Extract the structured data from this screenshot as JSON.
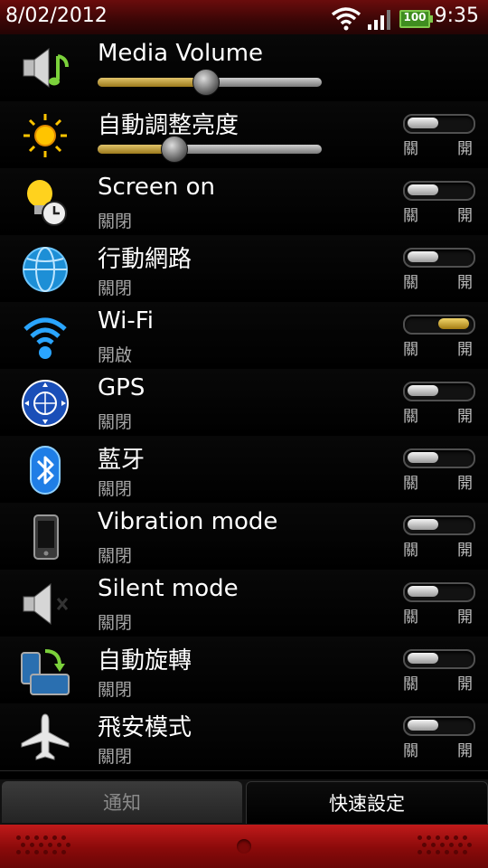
{
  "status_bar": {
    "date": "8/02/2012",
    "time": "9:35",
    "battery": "100"
  },
  "toggle_labels": {
    "off": "關",
    "on": "開"
  },
  "rows": [
    {
      "title": "Media Volume",
      "slider_level": 0.48
    },
    {
      "title": "自動調整亮度",
      "slider_level": 0.34,
      "toggle": "off"
    },
    {
      "title": "Screen on",
      "status": "關閉",
      "toggle": "off"
    },
    {
      "title": "行動網路",
      "status": "關閉",
      "toggle": "off"
    },
    {
      "title": "Wi-Fi",
      "status": "開啟",
      "toggle": "on"
    },
    {
      "title": "GPS",
      "status": "關閉",
      "toggle": "off"
    },
    {
      "title": "藍牙",
      "status": "關閉",
      "toggle": "off"
    },
    {
      "title": "Vibration mode",
      "status": "關閉",
      "toggle": "off"
    },
    {
      "title": "Silent mode",
      "status": "關閉",
      "toggle": "off"
    },
    {
      "title": "自動旋轉",
      "status": "關閉",
      "toggle": "off"
    },
    {
      "title": "飛安模式",
      "status": "關閉",
      "toggle": "off"
    }
  ],
  "tabs": {
    "notifications": "通知",
    "quick_settings": "快速設定",
    "active": "quick_settings"
  },
  "colors": {
    "accent_gold": "#c9a23a",
    "status_bar": "#4a0808",
    "bottom_bar": "#b01414"
  }
}
